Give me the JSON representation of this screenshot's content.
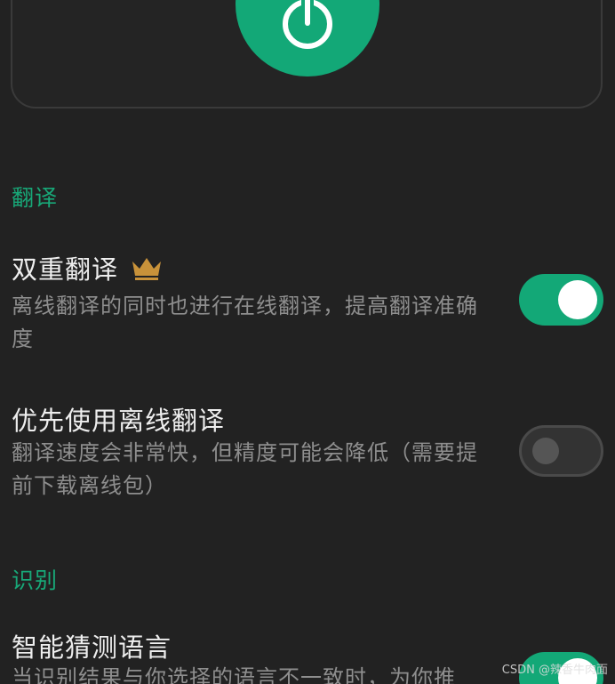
{
  "sections": {
    "translate": {
      "title": "翻译",
      "dual": {
        "title": "双重翻译",
        "desc": "离线翻译的同时也进行在线翻译，提高翻译准确度",
        "enabled": true,
        "premium_icon": "crown-icon"
      },
      "offline_first": {
        "title": "优先使用离线翻译",
        "desc": "翻译速度会非常快，但精度可能会降低（需要提前下载离线包）",
        "enabled": false
      }
    },
    "recognize": {
      "title": "识别",
      "smart_detect": {
        "title": "智能猜测语言",
        "desc": "当识别结果与你选择的语言不一致时，为你推",
        "enabled": true
      }
    }
  },
  "watermark": "CSDN @辣香牛肉面",
  "colors": {
    "accent": "#13a877",
    "background": "#222222",
    "crown": "#c8923a"
  }
}
